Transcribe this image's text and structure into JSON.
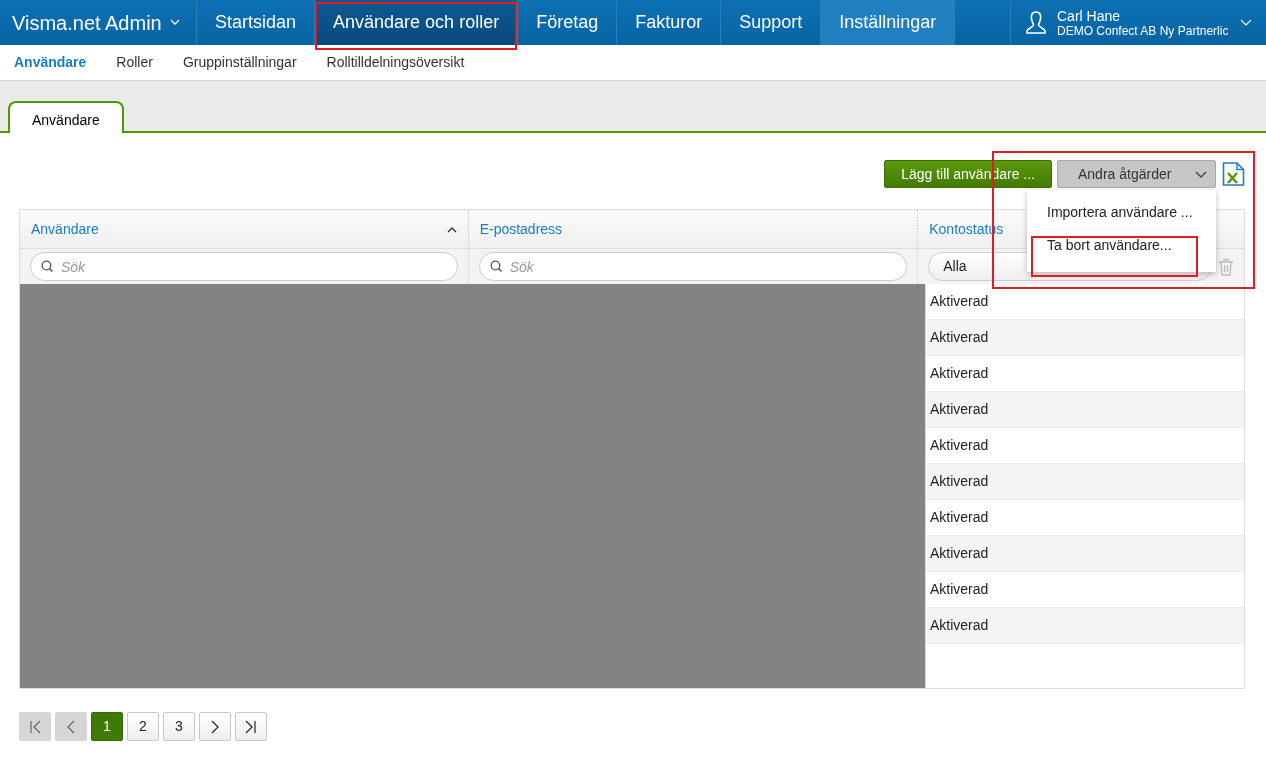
{
  "app": {
    "title": "Visma.net Admin"
  },
  "nav": [
    {
      "label": "Startsidan",
      "selected": false,
      "hovered": false,
      "highlighted": false
    },
    {
      "label": "Användare och roller",
      "selected": true,
      "hovered": false,
      "highlighted": true
    },
    {
      "label": "Företag",
      "selected": false,
      "hovered": false,
      "highlighted": false
    },
    {
      "label": "Fakturor",
      "selected": false,
      "hovered": false,
      "highlighted": false
    },
    {
      "label": "Support",
      "selected": false,
      "hovered": false,
      "highlighted": false
    },
    {
      "label": "Inställningar",
      "selected": false,
      "hovered": true,
      "highlighted": false
    }
  ],
  "user": {
    "name": "Carl Hane",
    "company": "DEMO Confect AB Ny Partnerlic"
  },
  "subnav": [
    {
      "label": "Användare",
      "selected": true
    },
    {
      "label": "Roller",
      "selected": false
    },
    {
      "label": "Gruppinställningar",
      "selected": false
    },
    {
      "label": "Rolltilldelningsöversikt",
      "selected": false
    }
  ],
  "tabs": [
    {
      "label": "Användare",
      "selected": true
    }
  ],
  "actions": {
    "primary": "Lägg till användare ...",
    "menu_button": "Andra åtgärder",
    "expanded": true,
    "highlighted": true,
    "menu": [
      {
        "label": "Importera användare ...",
        "highlighted": false
      },
      {
        "label": "Ta bort användare...",
        "highlighted": true
      }
    ]
  },
  "table": {
    "columns": [
      {
        "label": "Användare",
        "sorted": true
      },
      {
        "label": "E-postadress",
        "sorted": false
      },
      {
        "label": "Kontostatus",
        "sorted": false
      }
    ],
    "filters": [
      {
        "kind": "search",
        "placeholder": "Sök"
      },
      {
        "kind": "search",
        "placeholder": "Sök"
      },
      {
        "kind": "select",
        "value": "Alla"
      }
    ],
    "rows": [
      {
        "status": "Aktiverad"
      },
      {
        "status": "Aktiverad"
      },
      {
        "status": "Aktiverad"
      },
      {
        "status": "Aktiverad"
      },
      {
        "status": "Aktiverad"
      },
      {
        "status": "Aktiverad"
      },
      {
        "status": "Aktiverad"
      },
      {
        "status": "Aktiverad"
      },
      {
        "status": "Aktiverad"
      },
      {
        "status": "Aktiverad"
      }
    ]
  },
  "pagination": [
    {
      "kind": "first",
      "disabled": true
    },
    {
      "kind": "prev",
      "disabled": true
    },
    {
      "kind": "page",
      "label": "1",
      "selected": true
    },
    {
      "kind": "page",
      "label": "2",
      "selected": false
    },
    {
      "kind": "page",
      "label": "3",
      "selected": false
    },
    {
      "kind": "next",
      "disabled": false
    },
    {
      "kind": "last",
      "disabled": false
    }
  ]
}
